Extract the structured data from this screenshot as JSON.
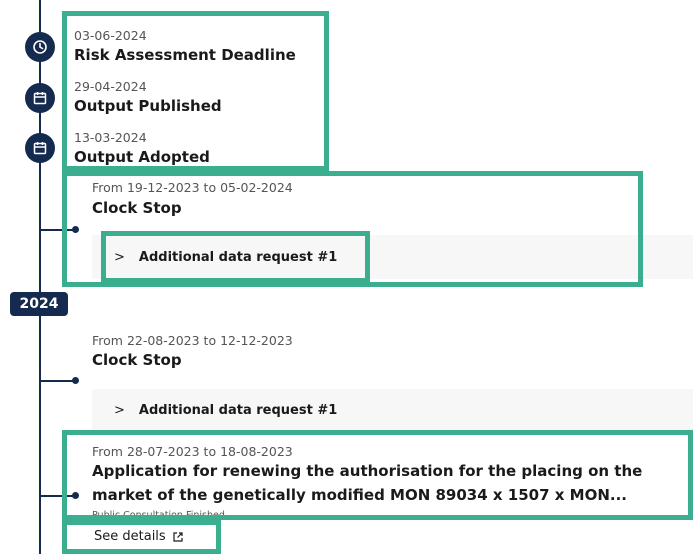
{
  "timeline": {
    "year_badge": "2024",
    "events": [
      {
        "date": "03-06-2024",
        "title": "Risk Assessment Deadline",
        "icon": "clock-icon"
      },
      {
        "date": "29-04-2024",
        "title": "Output Published",
        "icon": "calendar-icon"
      },
      {
        "date": "13-03-2024",
        "title": "Output Adopted",
        "icon": "calendar-icon"
      }
    ],
    "clock_stops": [
      {
        "range": "From 19-12-2023 to 05-02-2024",
        "title": "Clock Stop",
        "request": "Additional data request #1"
      },
      {
        "range": "From 22-08-2023 to 12-12-2023",
        "title": "Clock Stop",
        "request": "Additional data request #1"
      }
    ],
    "application": {
      "range": "From 28-07-2023 to 18-08-2023",
      "title_line1": "Application for renewing the authorisation for the placing on the",
      "title_line2": "market of the genetically modified MON 89034 x 1507 x MON...",
      "status": "Public Consultation Finished",
      "link_label": "See details",
      "link_icon": "external-link-icon"
    }
  },
  "colors": {
    "navy": "#152a4f",
    "highlight": "#3aae8f",
    "panel": "#f7f7f7"
  }
}
